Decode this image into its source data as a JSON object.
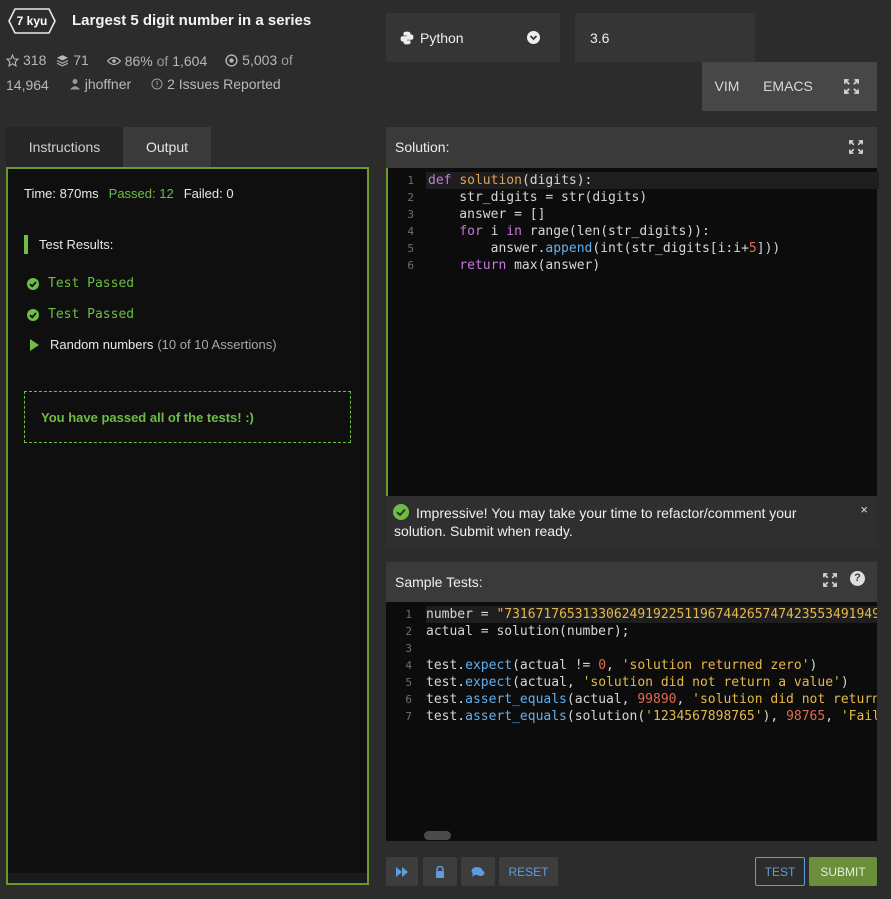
{
  "kata": {
    "rank": "7 kyu",
    "title": "Largest 5 digit number in a series",
    "stars": "318",
    "collections": "71",
    "satisfaction_pct": "86%",
    "satisfaction_of": "of",
    "satisfaction_total": "1,604",
    "completed": "5,003",
    "completed_of": "of",
    "completed_total": "14,964",
    "author": "jhoffner",
    "issues": "2 Issues Reported"
  },
  "toolbar": {
    "language": "Python",
    "version": "3.6",
    "vim_label": "VIM",
    "emacs_label": "EMACS"
  },
  "tabs": {
    "instructions": "Instructions",
    "output": "Output"
  },
  "output": {
    "time_label": "Time: 870ms",
    "passed_label": "Passed: 12",
    "failed_label": "Failed: 0",
    "results_title": "Test Results:",
    "test1": "Test Passed",
    "test2": "Test Passed",
    "group_name": "Random numbers",
    "group_assertions": "(10 of 10 Assertions)",
    "pass_message": "You have passed all of the tests! :)"
  },
  "solution": {
    "label": "Solution:",
    "notice": "Impressive! You may take your time to refactor/comment your solution. Submit when ready.",
    "close": "×"
  },
  "sample_tests": {
    "label": "Sample Tests:",
    "help": "?"
  },
  "buttons": {
    "reset": "RESET",
    "test": "TEST",
    "submit": "SUBMIT"
  },
  "colors": {
    "accent_green": "#6cbe45",
    "link_blue": "#5d9cdf",
    "submit_green": "#6b8e3a"
  }
}
